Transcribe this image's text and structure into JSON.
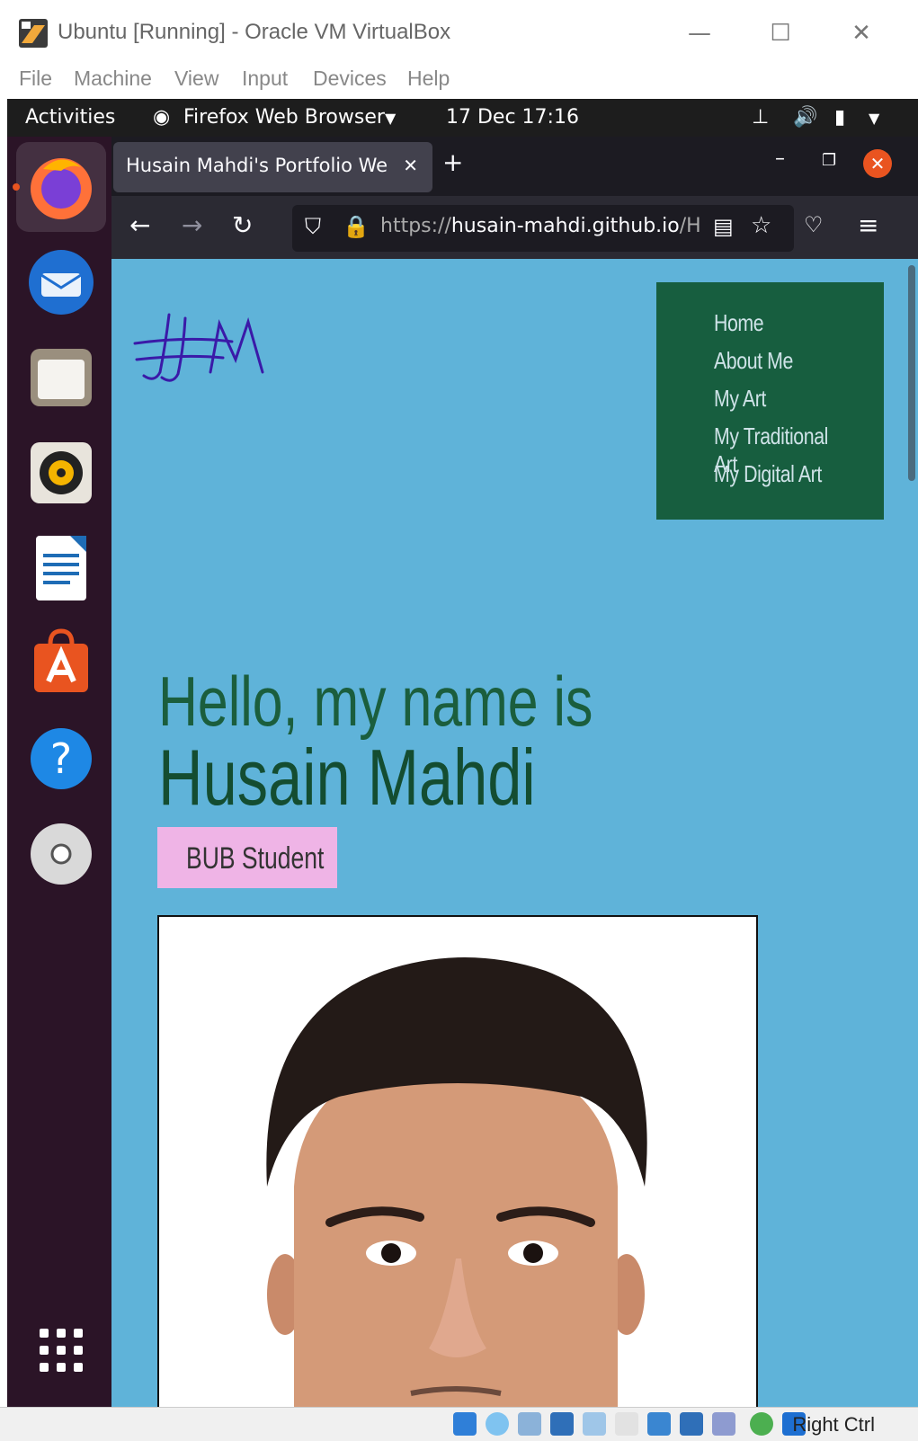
{
  "vbox": {
    "title": "Ubuntu [Running] - Oracle VM VirtualBox",
    "menu": [
      "File",
      "Machine",
      "View",
      "Input",
      "Devices",
      "Help"
    ],
    "host_key": "Right Ctrl"
  },
  "gnome": {
    "activities": "Activities",
    "app_name": "Firefox Web Browser",
    "datetime": "17 Dec  17:16"
  },
  "dock": {
    "items": [
      "firefox",
      "thunderbird",
      "files",
      "rhythmbox",
      "libreoffice-writer",
      "ubuntu-software",
      "help",
      "dvd"
    ]
  },
  "firefox": {
    "tab_title": "Husain Mahdi's Portfolio We",
    "url_scheme": "https://",
    "url_host": "husain-mahdi.github.io",
    "url_rest": "/H"
  },
  "site": {
    "logo_text": "HM",
    "nav": [
      "Home",
      "About Me",
      "My Art",
      "My Traditional Art",
      "My Digital Art"
    ],
    "greeting": "Hello, my name is",
    "name": "Husain Mahdi",
    "badge": "BUB Student"
  },
  "colors": {
    "page_bg": "#5fb3d9",
    "nav_bg": "#175e3f",
    "badge_bg": "#efb4e6",
    "heading": "#1b5e3d"
  }
}
